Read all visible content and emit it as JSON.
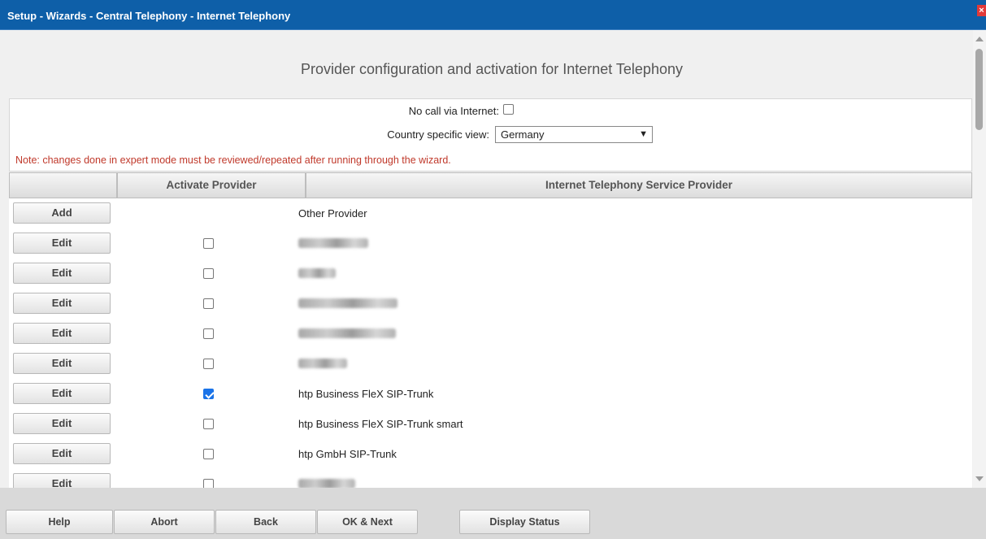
{
  "window": {
    "title": "Setup - Wizards - Central Telephony - Internet Telephony",
    "close_glyph": "×"
  },
  "page": {
    "heading": "Provider configuration and activation for Internet Telephony"
  },
  "form": {
    "no_call_label": "No call via Internet:",
    "no_call_checked": false,
    "country_label": "Country specific view:",
    "country_value": "Germany",
    "note": "Note: changes done in expert mode must be reviewed/repeated after running through the wizard."
  },
  "table": {
    "headers": [
      "",
      "Activate Provider",
      "Internet Telephony Service Provider"
    ],
    "rows": [
      {
        "button": "Add",
        "checked": null,
        "provider": "Other Provider",
        "redacted": false
      },
      {
        "button": "Edit",
        "checked": false,
        "provider": "",
        "redacted": true
      },
      {
        "button": "Edit",
        "checked": false,
        "provider": "",
        "redacted": true
      },
      {
        "button": "Edit",
        "checked": false,
        "provider": "",
        "redacted": true
      },
      {
        "button": "Edit",
        "checked": false,
        "provider": "",
        "redacted": true
      },
      {
        "button": "Edit",
        "checked": false,
        "provider": "",
        "redacted": true
      },
      {
        "button": "Edit",
        "checked": true,
        "provider": "htp Business FleX SIP-Trunk",
        "redacted": false
      },
      {
        "button": "Edit",
        "checked": false,
        "provider": "htp Business FleX SIP-Trunk smart",
        "redacted": false
      },
      {
        "button": "Edit",
        "checked": false,
        "provider": "htp GmbH SIP-Trunk",
        "redacted": false
      },
      {
        "button": "Edit",
        "checked": false,
        "provider": "",
        "redacted": true
      }
    ]
  },
  "footer": {
    "help": "Help",
    "abort": "Abort",
    "back": "Back",
    "ok_next": "OK & Next",
    "display_status": "Display Status"
  },
  "colors": {
    "titlebar": "#0e5fa8",
    "note": "#c0392b",
    "checkbox_on": "#1a73e8"
  }
}
